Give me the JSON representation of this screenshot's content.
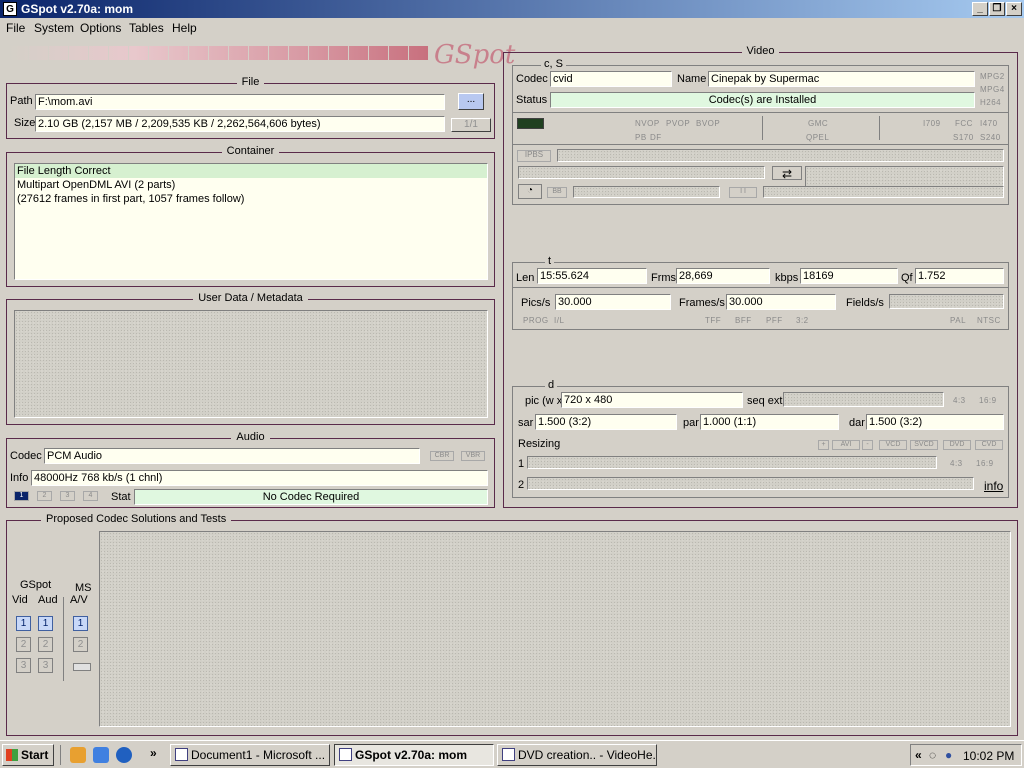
{
  "window": {
    "title": "GSpot v2.70a: mom"
  },
  "menu": [
    "File",
    "System",
    "Options",
    "Tables",
    "Help"
  ],
  "logo": "GSpot",
  "file": {
    "title": "File",
    "path_label": "Path",
    "path_value": "F:\\mom.avi",
    "browse_label": "...",
    "size_label": "Size",
    "size_value": "2.10 GB (2,157 MB / 2,209,535 KB / 2,262,564,606 bytes)",
    "part_label": "1/1"
  },
  "container": {
    "title": "Container",
    "lines": [
      "File Length Correct",
      "Multipart OpenDML AVI (2 parts)",
      "(27612 frames in first part, 1057 frames follow)"
    ]
  },
  "userdata": {
    "title": "User Data / Metadata"
  },
  "audio": {
    "title": "Audio",
    "codec_label": "Codec",
    "codec_value": "PCM Audio",
    "cbr": "CBR",
    "vbr": "VBR",
    "info_label": "Info",
    "info_value": "48000Hz  768 kb/s (1 chnl)",
    "tracks": [
      "1",
      "2",
      "3",
      "4"
    ],
    "stat_label": "Stat",
    "stat_value": "No Codec Required"
  },
  "video": {
    "title": "Video",
    "cs_title": "c, S",
    "codec_label": "Codec",
    "codec_value": "cvid",
    "name_label": "Name",
    "name_value": "Cinepak by Supermac",
    "status_label": "Status",
    "status_value": "Codec(s) are Installed",
    "side_tags": [
      "MPG2",
      "MPG4",
      "H264"
    ],
    "tags_row1": [
      "NVOP",
      "PVOP",
      "BVOP",
      "GMC",
      "I709",
      "FCC",
      "I470"
    ],
    "tags_row2": [
      "PB",
      "DF",
      "QPEL",
      "S170",
      "S240"
    ],
    "ipbs": "IPBS",
    "bb": "BB",
    "ii": "I  I",
    "t_title": "t",
    "len_label": "Len",
    "len_value": "15:55.624",
    "frms_label": "Frms",
    "frms_value": "28,669",
    "kbps_label": "kbps",
    "kbps_value": "18169",
    "qf_label": "Qf",
    "qf_value": "1.752",
    "pics_label": "Pics/s",
    "pics_value": "30.000",
    "frames_label": "Frames/s",
    "frames_value": "30.000",
    "fields_label": "Fields/s",
    "tags_row3": [
      "PROG",
      "I/L",
      "TFF",
      "BFF",
      "PFF",
      "3:2",
      "PAL",
      "NTSC"
    ],
    "d_title": "d",
    "pic_label": "pic (w x",
    "pic_value": "720 x 480",
    "seqext_label": "seq ext",
    "ar_tags": [
      "4:3",
      "16:9"
    ],
    "sar_label": "sar",
    "sar_value": "1.500 (3:2)",
    "par_label": "par",
    "par_value": "1.000 (1:1)",
    "dar_label": "dar",
    "dar_value": "1.500 (3:2)",
    "resizing_label": "Resizing",
    "resize_tags": [
      "+",
      "AVI",
      "-",
      "VCD",
      "SVCD",
      "DVD",
      "CVD"
    ],
    "row1_label": "1",
    "row2_label": "2",
    "ar_tags2": [
      "4:3",
      "16:9"
    ],
    "info_link": "info"
  },
  "proposed": {
    "title": "Proposed Codec Solutions and Tests",
    "gspot_label": "GSpot",
    "vid_label": "Vid",
    "aud_label": "Aud",
    "ms_label": "MS",
    "av_label": "A/V",
    "nums": [
      "1",
      "2",
      "3"
    ]
  },
  "taskbar": {
    "start": "Start",
    "more": "»",
    "tasks": [
      "Document1 - Microsoft ...",
      "GSpot v2.70a: mom",
      "DVD creation.. - VideoHe..."
    ],
    "tray_more": "«",
    "clock": "10:02 PM"
  },
  "colors": {
    "titlebar": "#0a246a",
    "group_border": "#5a2a4a",
    "status_green": "#e0f8e0",
    "logo": "#c8808c"
  }
}
